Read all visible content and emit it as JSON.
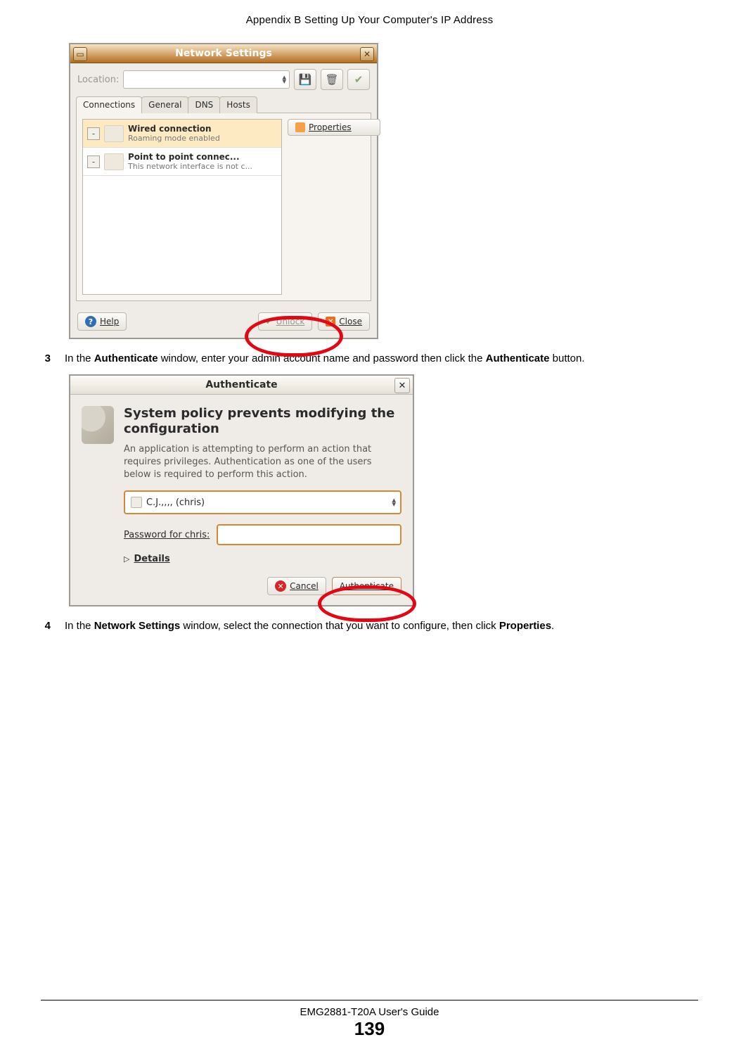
{
  "header": "Appendix B Setting Up Your Computer's IP Address",
  "step3": {
    "num": "3",
    "pre": "In the ",
    "b1": "Authenticate",
    "mid": " window, enter your admin account name and password then click the ",
    "b2": "Authenticate",
    "post": " button."
  },
  "step4": {
    "num": "4",
    "pre": "In the ",
    "b1": "Network Settings",
    "mid": " window, select the connection that you want to configure, then click ",
    "b2": "Properties",
    "post": "."
  },
  "footer": {
    "guide": "EMG2881-T20A User's Guide",
    "page": "139"
  },
  "fig1": {
    "title": "Network Settings",
    "close_x": "✕",
    "menu_glyph": "▭",
    "location_label": "Location:",
    "disk_tip": "💾",
    "trash_tip": "🗑",
    "check_tip": "✔",
    "tabs": {
      "connections": "Connections",
      "general": "General",
      "dns": "DNS",
      "hosts": "Hosts"
    },
    "conn1": {
      "title": "Wired connection",
      "sub": "Roaming mode enabled"
    },
    "conn2": {
      "title": "Point to point connec...",
      "sub": "This network interface is not c..."
    },
    "toggle": "-",
    "properties": "Properties",
    "help": "Help",
    "unlock": "Unlock",
    "close": "Close"
  },
  "fig2": {
    "title": "Authenticate",
    "close_x": "✕",
    "h": "System policy prevents modifying the configuration",
    "desc": "An application is attempting to perform an action that requires privileges. Authentication as one of the users below is required to perform this action.",
    "user": "C.J.,,,, (chris)",
    "pw_label": "Password for chris:",
    "details": "Details",
    "tri": "▷",
    "cancel": "Cancel",
    "auth": "Authenticate"
  }
}
